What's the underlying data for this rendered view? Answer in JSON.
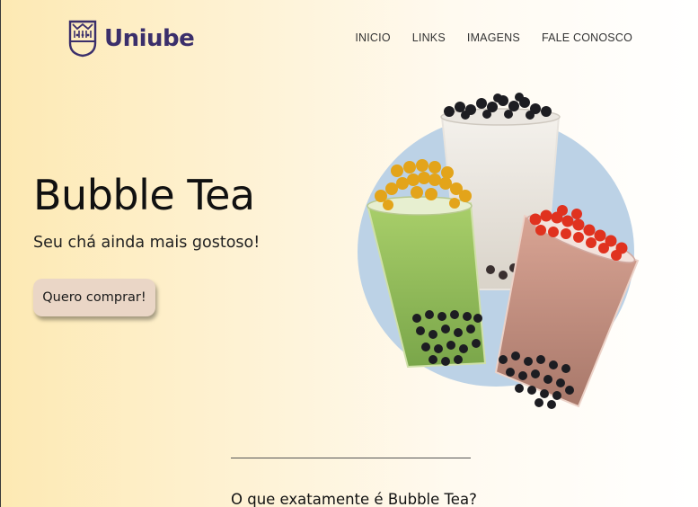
{
  "brand": {
    "name": "Uniube",
    "color": "#3b2f6b"
  },
  "nav": {
    "items": [
      {
        "label": "INICIO"
      },
      {
        "label": "LINKS"
      },
      {
        "label": "IMAGENS"
      },
      {
        "label": "FALE CONOSCO"
      }
    ]
  },
  "hero": {
    "title": "Bubble Tea",
    "subtitle": "Seu chá ainda mais gostoso!",
    "button_label": "Quero comprar!",
    "button_color": "#ead6c6",
    "image_icon": "bubble-tea-cups-illustration",
    "circle_color": "#bcd2e6"
  },
  "section": {
    "title": "O que exatamente é Bubble Tea?"
  }
}
